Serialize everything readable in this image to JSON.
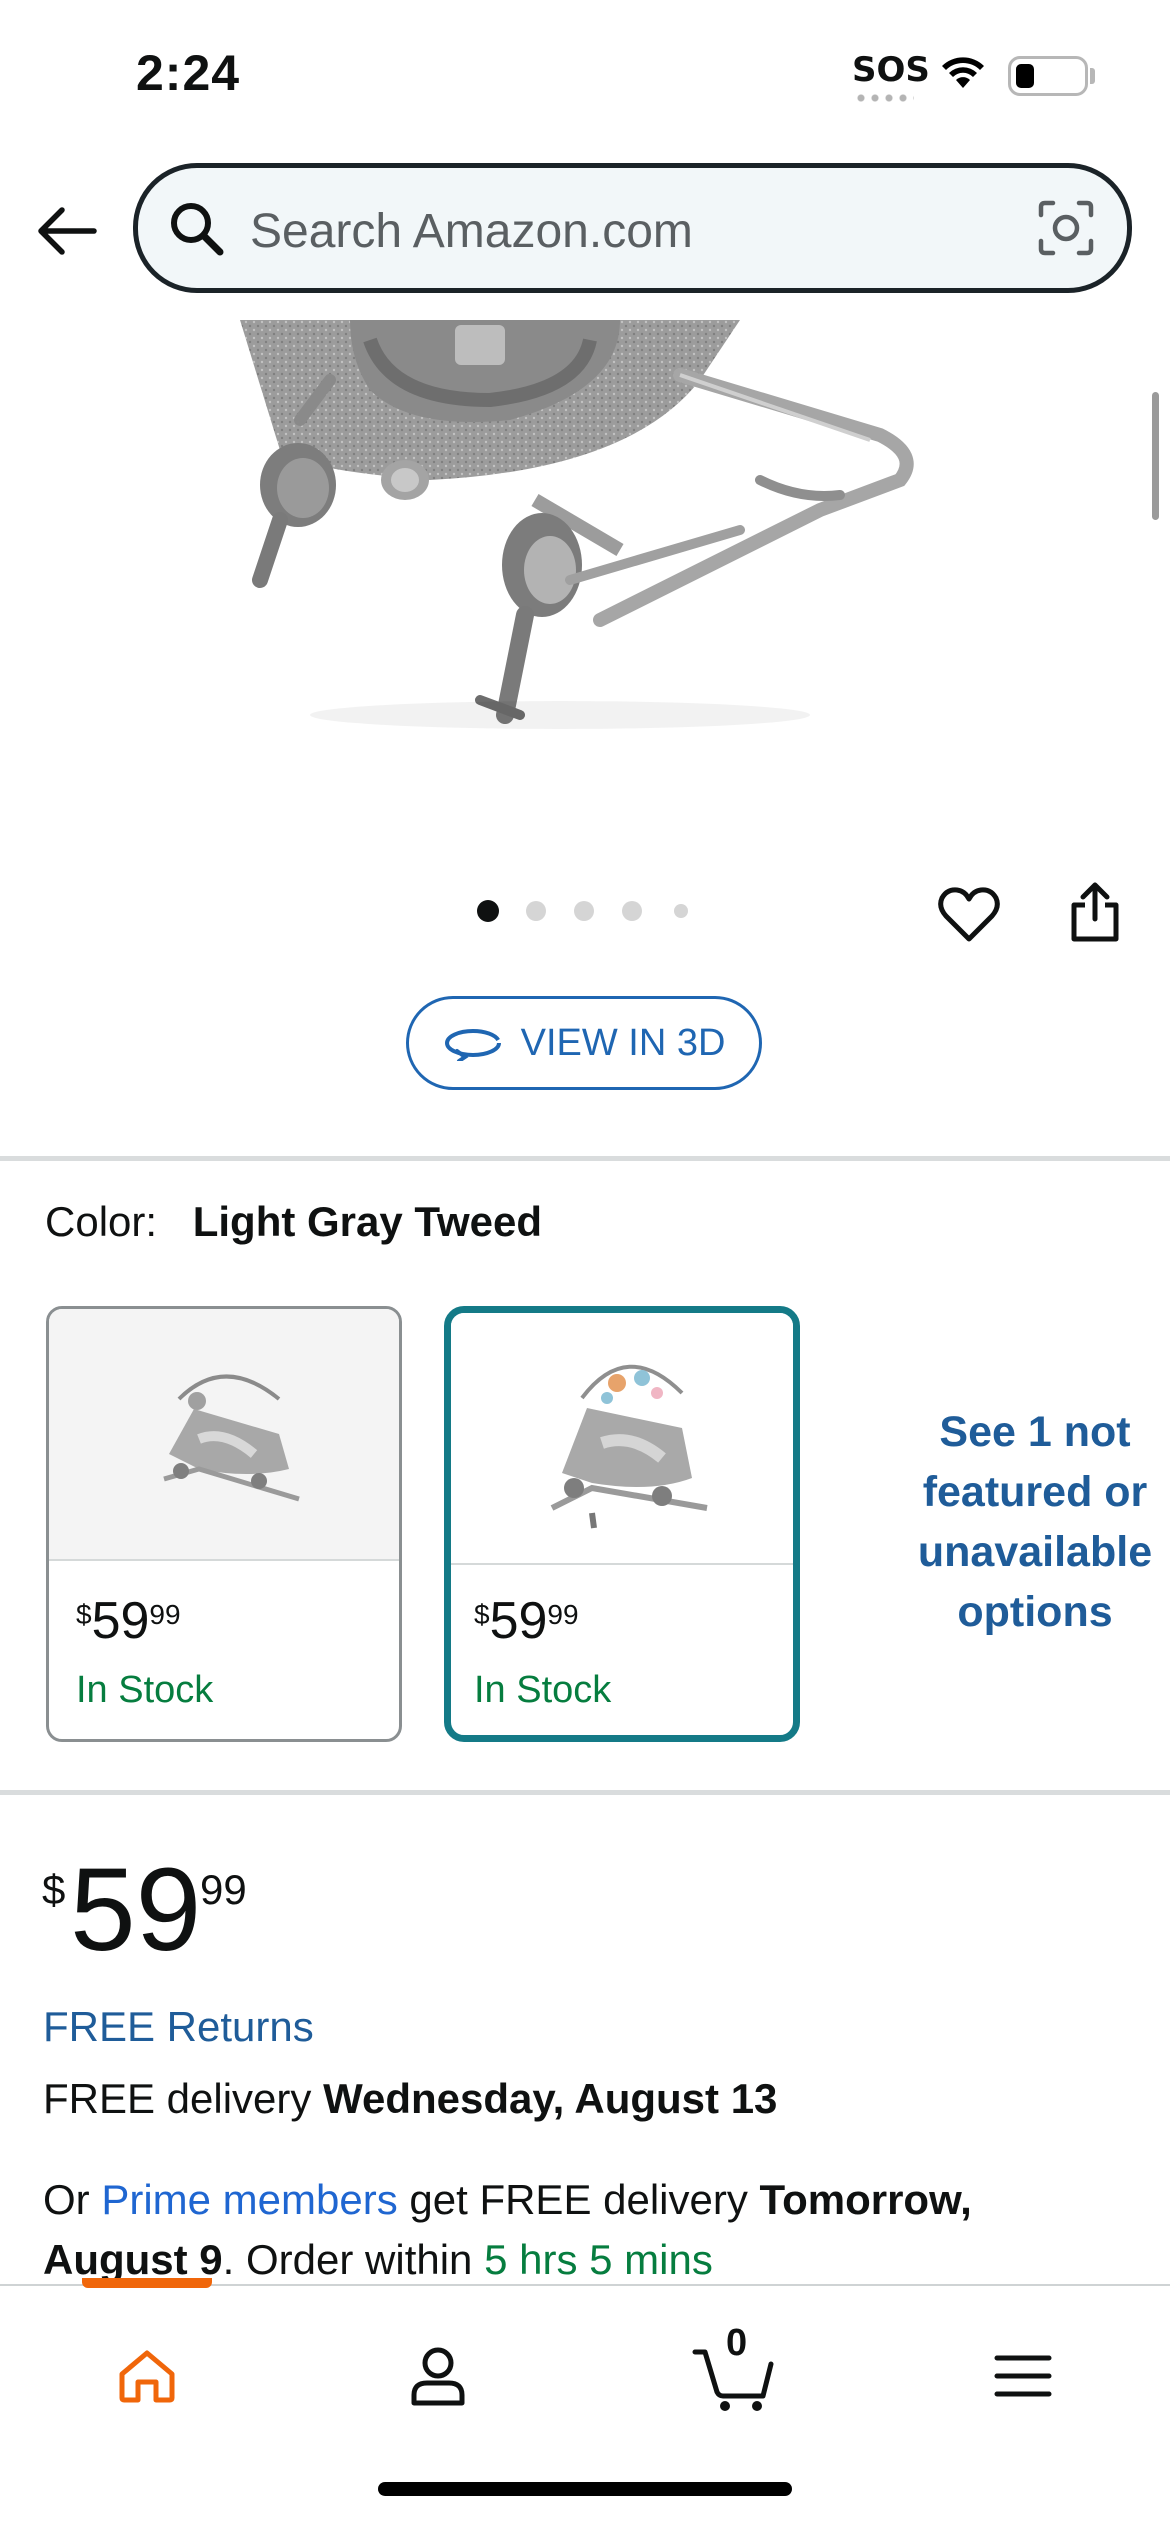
{
  "status_bar": {
    "time": "2:24",
    "sos": "SOS",
    "battery_level": 0.25
  },
  "header": {
    "search_placeholder": "Search Amazon.com"
  },
  "gallery": {
    "image_count": 5,
    "current_index": 0,
    "view3d_label": "VIEW IN 3D"
  },
  "color_section": {
    "label": "Color:",
    "selected_value": "Light Gray Tweed",
    "options": [
      {
        "price_whole": "59",
        "price_fraction": "99",
        "currency": "$",
        "stock": "In Stock",
        "selected": false
      },
      {
        "price_whole": "59",
        "price_fraction": "99",
        "currency": "$",
        "stock": "In Stock",
        "selected": true
      }
    ],
    "see_more": "See 1 not featured or unavailable options"
  },
  "price": {
    "currency": "$",
    "whole": "59",
    "fraction": "99"
  },
  "returns": "FREE Returns",
  "delivery": {
    "prefix": "FREE delivery",
    "date": "Wednesday, August 13"
  },
  "prime": {
    "or": "Or",
    "link": "Prime members",
    "middle": "get FREE delivery",
    "date": "Tomorrow, August 9",
    "order_within": ". Order within",
    "countdown": "5 hrs 5 mins"
  },
  "bottom_nav": {
    "cart_count": "0",
    "items": [
      "home-icon",
      "account-icon",
      "cart-icon",
      "menu-icon"
    ]
  },
  "colors": {
    "accent_orange": "#f0660a",
    "link_blue": "#1f66b2",
    "stock_green": "#067d3f",
    "selected_teal": "#147a87"
  }
}
